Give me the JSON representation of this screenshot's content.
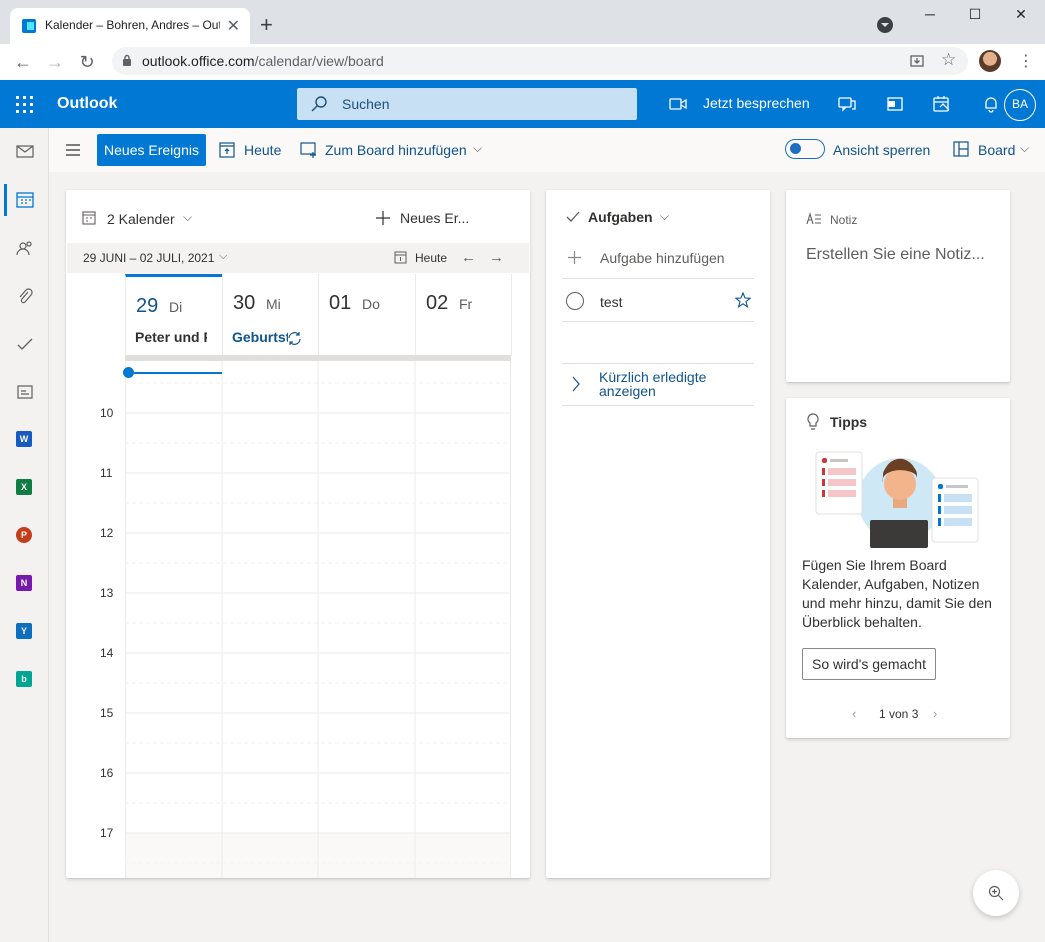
{
  "browser": {
    "tab_title": "Kalender – Bohren, Andres – Outlook",
    "url_host": "outlook.office.com",
    "url_path": "/calendar/view/board"
  },
  "header": {
    "app_name": "Outlook",
    "search_placeholder": "Suchen",
    "meet_now": "Jetzt besprechen",
    "user_initials": "BA",
    "brand_color": "#0078d4"
  },
  "rail": {
    "apps": [
      {
        "name": "Word",
        "letter": "W",
        "color": "#185abd"
      },
      {
        "name": "Excel",
        "letter": "X",
        "color": "#107c41"
      },
      {
        "name": "PowerPoint",
        "letter": "P",
        "color": "#c43e1c"
      },
      {
        "name": "OneNote",
        "letter": "N",
        "color": "#7719aa"
      },
      {
        "name": "Yammer",
        "letter": "Y",
        "color": "#106ebe"
      },
      {
        "name": "Bookings",
        "letter": "b",
        "color": "#00a693"
      }
    ]
  },
  "command_bar": {
    "new_event": "Neues Ereignis",
    "today": "Heute",
    "add_to_board": "Zum Board hinzufügen",
    "lock_view": "Ansicht sperren",
    "view": "Board"
  },
  "calendar_card": {
    "calendars_count": "2 Kalender",
    "new_event": "Neues Er...",
    "date_range": "29 JUNI – 02 JULI, 2021",
    "today": "Heute",
    "days": [
      {
        "num": "29",
        "name": "Di",
        "event": "Peter und F",
        "is_today": true
      },
      {
        "num": "30",
        "name": "Mi",
        "event": "Geburtst",
        "is_today": false
      },
      {
        "num": "01",
        "name": "Do",
        "event": "",
        "is_today": false
      },
      {
        "num": "02",
        "name": "Fr",
        "event": "",
        "is_today": false
      }
    ],
    "hours": [
      "10",
      "11",
      "12",
      "13",
      "14",
      "15",
      "16",
      "17"
    ]
  },
  "tasks_card": {
    "title": "Aufgaben",
    "add_task": "Aufgabe hinzufügen",
    "tasks": [
      {
        "text": "test"
      }
    ],
    "completed_link": "Kürzlich erledigte anzeigen"
  },
  "note_card": {
    "label": "Notiz",
    "placeholder": "Erstellen Sie eine Notiz..."
  },
  "tips_card": {
    "title": "Tipps",
    "text": "Fügen Sie Ihrem Board Kalender, Aufgaben, Notizen und mehr hinzu, damit Sie den Überblick behalten.",
    "button": "So wird's gemacht",
    "pager": "1 von 3"
  }
}
